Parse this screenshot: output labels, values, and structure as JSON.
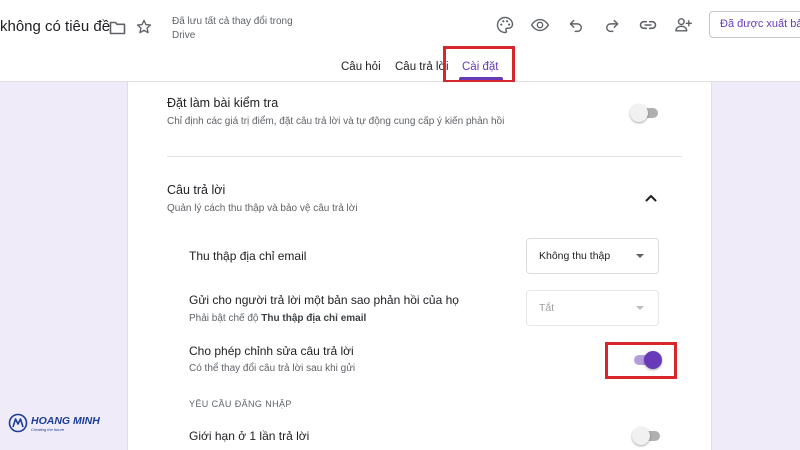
{
  "header": {
    "doc_title": "không có tiêu đề",
    "save_status_line1": "Đã lưu tất cả thay đổi trong",
    "save_status_line2": "Drive",
    "publish_label": "Đã được xuất bả",
    "icons": [
      "folder-icon",
      "star-icon",
      "palette-icon",
      "eye-icon",
      "undo-icon",
      "redo-icon",
      "link-icon",
      "add-person-icon"
    ]
  },
  "tabs": [
    {
      "label": "Câu hỏi",
      "active": false
    },
    {
      "label": "Câu trả lời",
      "active": false
    },
    {
      "label": "Cài đặt",
      "active": true
    }
  ],
  "settings": {
    "quiz": {
      "title": "Đặt làm bài kiểm tra",
      "description": "Chỉ định các giá trị điểm, đặt câu trả lời và tự động cung cấp ý kiến phản hồi",
      "enabled": false
    },
    "responses": {
      "title": "Câu trả lời",
      "description": "Quản lý cách thu thập và bảo vệ câu trả lời",
      "collect_email": {
        "label": "Thu thập địa chỉ email",
        "value": "Không thu thập"
      },
      "send_copy": {
        "label": "Gửi cho người trả lời một bản sao phản hồi của họ",
        "hint_prefix": "Phải bật chế độ",
        "hint_bold": "Thu thập địa chỉ email",
        "value": "Tắt"
      },
      "allow_edit": {
        "label": "Cho phép chỉnh sửa câu trả lời",
        "description": "Có thể thay đổi câu trả lời sau khi gửi",
        "enabled": true
      },
      "login_section": "YÊU CẦU ĐĂNG NHẬP",
      "limit_one": {
        "label": "Giới hạn ở 1 lần trả lời",
        "enabled": false
      }
    }
  },
  "watermark": {
    "name": "HOANG MINH",
    "tagline": "Creating the future"
  },
  "colors": {
    "accent": "#673ab7",
    "highlight": "#d9262b",
    "background": "#f0ebf8"
  }
}
